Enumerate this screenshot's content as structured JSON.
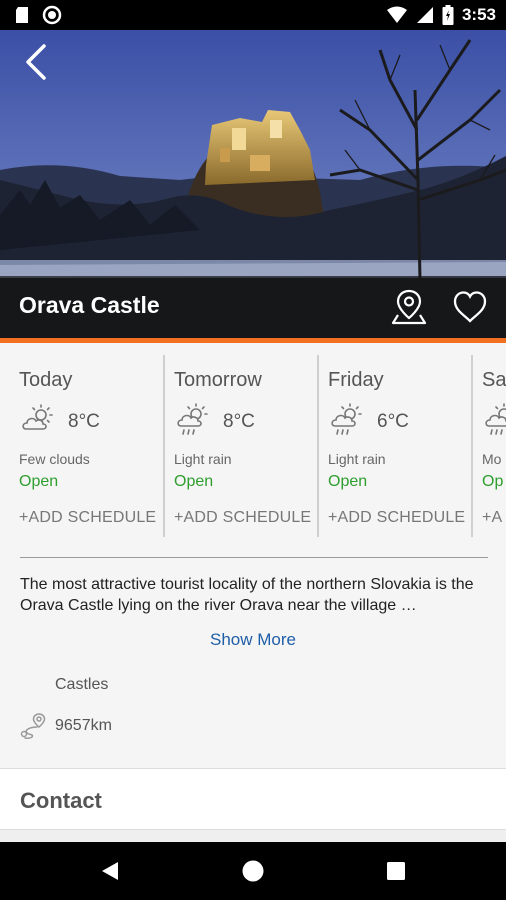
{
  "status_bar": {
    "time": "3:53",
    "left_icons": [
      "sd-card-icon",
      "record-icon"
    ],
    "right_icons": [
      "wifi-icon",
      "cell-signal-icon",
      "battery-icon"
    ]
  },
  "hero": {
    "title": "Orava Castle",
    "back_icon": "chevron-left-icon",
    "map_pin_icon": "map-pin-icon",
    "favorite_icon": "heart-icon"
  },
  "colors": {
    "accent": "#f36f21",
    "open": "#2e9e2e",
    "link": "#1f5ea8"
  },
  "weather": {
    "days": [
      {
        "name": "Today",
        "temp": "8°C",
        "desc": "Few clouds",
        "status": "Open",
        "action": "+ADD SCHEDULE",
        "icon": "sun-cloud-icon"
      },
      {
        "name": "Tomorrow",
        "temp": "8°C",
        "desc": "Light rain",
        "status": "Open",
        "action": "+ADD SCHEDULE",
        "icon": "sun-rain-icon"
      },
      {
        "name": "Friday",
        "temp": "6°C",
        "desc": "Light rain",
        "status": "Open",
        "action": "+ADD SCHEDULE",
        "icon": "sun-rain-icon"
      },
      {
        "name": "Sa",
        "temp": "",
        "desc": "Mo",
        "status": "Op",
        "action": "+A",
        "icon": "sun-rain-icon"
      }
    ]
  },
  "description": {
    "text": "The most attractive tourist locality of the northern Slovakia is the Orava Castle lying on the river Orava near the village …",
    "show_more": "Show More"
  },
  "info": {
    "category": "Castles",
    "distance": "9657km",
    "distance_icon": "route-icon"
  },
  "contact": {
    "title": "Contact"
  },
  "nav_bar": {
    "icons": [
      "nav-back-icon",
      "nav-home-icon",
      "nav-recents-icon"
    ]
  }
}
